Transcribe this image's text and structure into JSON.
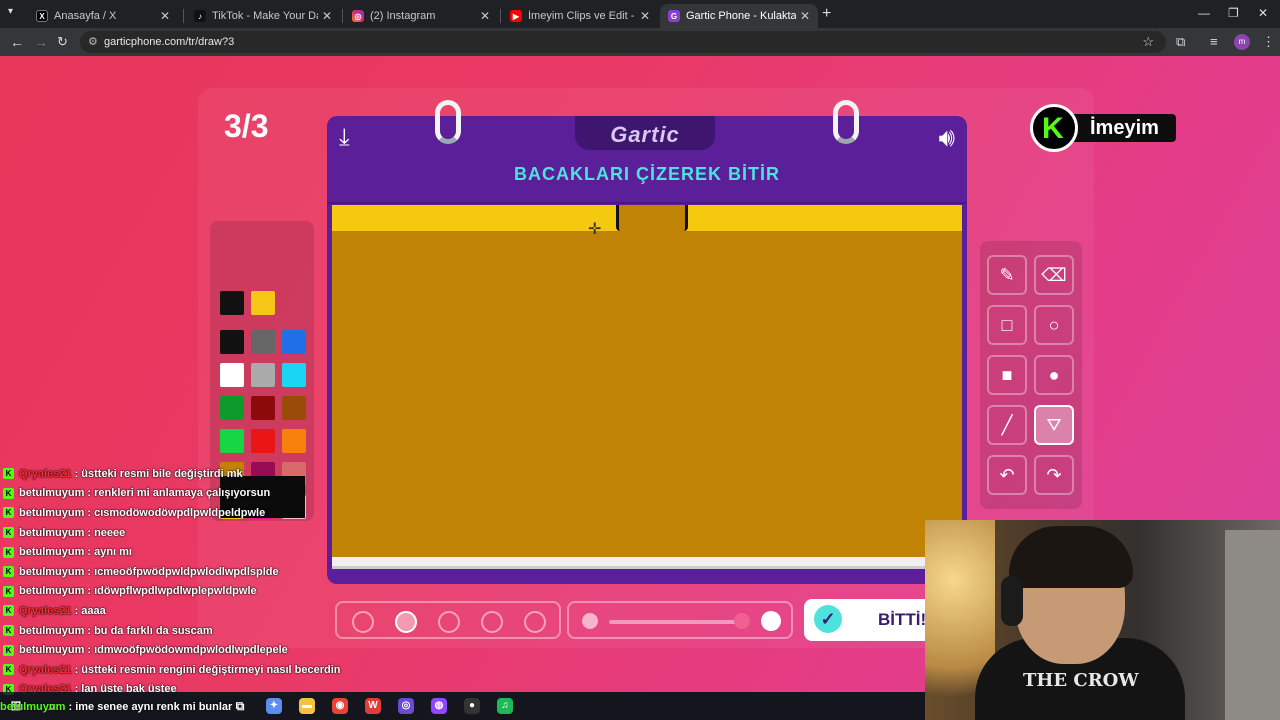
{
  "browser": {
    "tabs": [
      {
        "title": "Anasayfa / X",
        "favicon": "x-icon",
        "active": false
      },
      {
        "title": "TikTok - Make Your Day",
        "favicon": "tiktok-icon",
        "active": false
      },
      {
        "title": "(2) Instagram",
        "favicon": "instagram-icon",
        "active": false
      },
      {
        "title": "İmeyim Clips ve Edit - YouTube",
        "favicon": "youtube-icon",
        "active": false
      },
      {
        "title": "Gartic Phone - Kulaktan Kulağa",
        "favicon": "gartic-icon",
        "active": true
      }
    ],
    "url": "garticphone.com/tr/draw?3",
    "profile_initial": "m"
  },
  "game": {
    "round": "3/3",
    "brand": "Gartic",
    "prompt": "BACAKLARI ÇİZEREK BİTİR",
    "done_label": "BİTTİ!",
    "streamer_logo_letter": "K",
    "streamer_logo_text": "İmeyim",
    "canvas_colors": {
      "background": "#c08306",
      "strip": "#f5c90f"
    },
    "selected_tool": "fill",
    "selected_size_index": 1,
    "palette": {
      "current": [
        "#111111",
        "#f5c518"
      ],
      "swatches": [
        "#111111",
        "#666666",
        "#1f6fe6",
        "#ffffff",
        "#aaaaaa",
        "#1bd6f2",
        "#0c9a2a",
        "#8c0a0a",
        "#9b4b08",
        "#16d645",
        "#ea1616",
        "#f77f0b",
        "#c08306",
        "#9a0b55",
        "#d86a6a",
        "#f5c90f",
        "#e8118a",
        "#f8bfbf"
      ]
    },
    "tools": [
      "pencil-icon",
      "eraser-icon",
      "rectangle-outline-icon",
      "circle-outline-icon",
      "rectangle-fill-icon",
      "circle-fill-icon",
      "line-icon",
      "fill-bucket-icon",
      "undo-icon",
      "redo-icon"
    ]
  },
  "chat": [
    {
      "user": "Qryales21",
      "text": "üstteki resmi bile değiştirdi mk",
      "red": true
    },
    {
      "user": "betulmuyum",
      "text": "renkleri mi anlamaya çalışıyorsun",
      "red": false
    },
    {
      "user": "betulmuyum",
      "text": "cısmodöwodöwpdlpwldpeldpwle",
      "red": false
    },
    {
      "user": "betulmuyum",
      "text": "neeee",
      "red": false
    },
    {
      "user": "betulmuyum",
      "text": "aynı mı",
      "red": false
    },
    {
      "user": "betulmuyum",
      "text": "ıcmeoöfpwödpwldpwlodlwpdlsplde",
      "red": false
    },
    {
      "user": "betulmuyum",
      "text": "ıdöwpflwpdlwpdlwplepwldpwle",
      "red": false
    },
    {
      "user": "Qryales21",
      "text": "aaaa",
      "red": true
    },
    {
      "user": "betulmuyum",
      "text": "bu da farklı da suscam",
      "red": false
    },
    {
      "user": "betulmuyum",
      "text": "ıdmwoöfpwödowmdpwlodlwpdlepele",
      "red": false
    },
    {
      "user": "Qryales21",
      "text": "üstteki resmin rengini değiştirmeyi nasıl becerdin",
      "red": true
    },
    {
      "user": "Qryales21",
      "text": "lan üste bak üstee",
      "red": true
    }
  ],
  "last_message": {
    "user": "betulmuyum",
    "text": "ime senee aynı renk mi bunlar"
  },
  "webcam": {
    "shirt_text": "THE CROW"
  },
  "taskbar": {
    "apps": [
      {
        "name": "copilot-icon",
        "color": "#5b8ef0"
      },
      {
        "name": "file-explorer-icon",
        "color": "#f2c341"
      },
      {
        "name": "chrome-icon",
        "color": "#e94235"
      },
      {
        "name": "wps-icon",
        "color": "#e23b3b"
      },
      {
        "name": "obs-icon",
        "color": "#6b4bd3"
      },
      {
        "name": "twitch-icon",
        "color": "#9146ff"
      },
      {
        "name": "recorder-icon",
        "color": "#333333"
      },
      {
        "name": "spotify-icon",
        "color": "#1db954"
      }
    ]
  }
}
